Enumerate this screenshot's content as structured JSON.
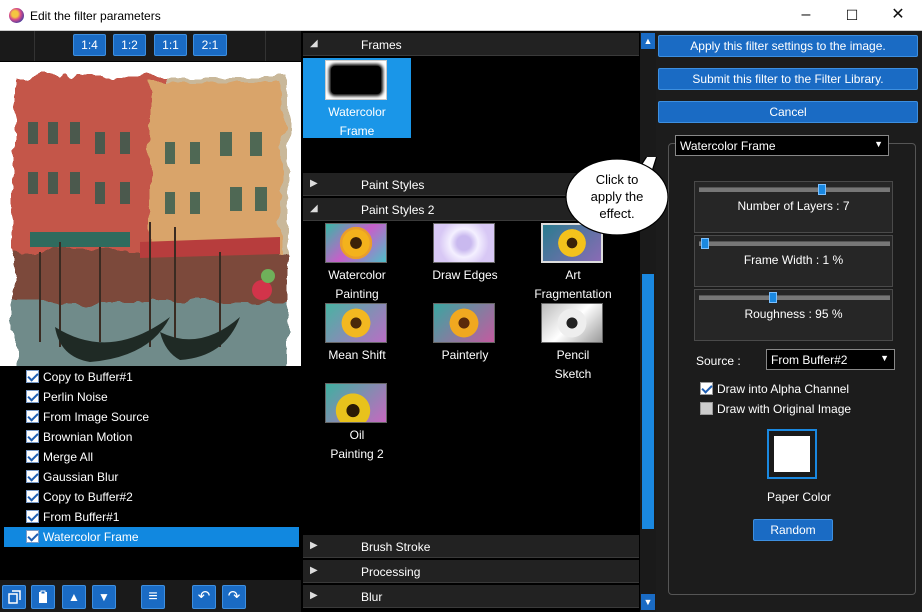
{
  "window": {
    "title": "Edit the filter parameters",
    "minimize": "–",
    "maximize": "☐",
    "close": "✕"
  },
  "zoom": {
    "buttons": [
      "1:4",
      "1:2",
      "1:1",
      "2:1"
    ]
  },
  "layers": [
    {
      "label": "Copy to Buffer#1",
      "checked": true
    },
    {
      "label": "Perlin Noise",
      "checked": true
    },
    {
      "label": "From Image Source",
      "checked": true
    },
    {
      "label": "Brownian Motion",
      "checked": true
    },
    {
      "label": "Merge All",
      "checked": true
    },
    {
      "label": "Gaussian Blur",
      "checked": true
    },
    {
      "label": "Copy to Buffer#2",
      "checked": true
    },
    {
      "label": "From Buffer#1",
      "checked": true
    },
    {
      "label": "Watercolor Frame",
      "checked": true,
      "selected": true
    }
  ],
  "toolbar": {
    "new": "new-layer-icon",
    "paste": "clipboard-icon",
    "up": "▲",
    "down": "▼",
    "menu": "≡",
    "undo": "↶",
    "redo": "↷"
  },
  "categories": {
    "frames": {
      "label": "Frames",
      "expanded": true,
      "items": [
        {
          "label1": "Watercolor",
          "label2": "Frame"
        }
      ]
    },
    "paint_styles": {
      "label": "Paint Styles",
      "expanded": false
    },
    "paint_styles_2": {
      "label": "Paint Styles 2",
      "expanded": true,
      "items": [
        {
          "label1": "Watercolor",
          "label2": "Painting"
        },
        {
          "label1": "Draw Edges",
          "label2": ""
        },
        {
          "label1": "Art",
          "label2": "Fragmentation"
        },
        {
          "label1": "Mean Shift",
          "label2": ""
        },
        {
          "label1": "Painterly",
          "label2": ""
        },
        {
          "label1": "Pencil",
          "label2": "Sketch"
        },
        {
          "label1": "Oil",
          "label2": "Painting 2"
        }
      ]
    },
    "brush_stroke": {
      "label": "Brush Stroke",
      "expanded": false
    },
    "processing": {
      "label": "Processing",
      "expanded": false
    },
    "blur": {
      "label": "Blur",
      "expanded": false
    }
  },
  "actions": {
    "apply": "Apply this filter settings to the image.",
    "submit": "Submit this filter to the Filter Library.",
    "cancel": "Cancel"
  },
  "callout": {
    "line1": "Click to",
    "line2": "apply the",
    "line3": "effect."
  },
  "settings": {
    "filter_select": "Watercolor Frame",
    "layers_label": "Number of Layers : 7",
    "layers_value": 0.65,
    "frame_width_label": "Frame Width : 1 %",
    "frame_width_value": 0.01,
    "roughness_label": "Roughness : 95 %",
    "roughness_value": 0.38,
    "source_label": "Source :",
    "source_value": "From Buffer#2",
    "alpha_label": "Draw into Alpha Channel",
    "alpha_checked": true,
    "original_label": "Draw with Original Image",
    "original_checked": false,
    "paper_color_label": "Paper Color",
    "paper_color": "#ffffff",
    "random_label": "Random"
  },
  "colors": {
    "accent": "#1a88e0",
    "selection": "#1a96e8",
    "panel": "#000000"
  }
}
